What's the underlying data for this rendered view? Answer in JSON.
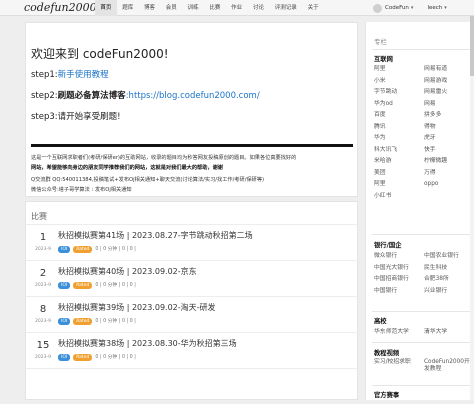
{
  "app": {
    "logo": "codefun2000"
  },
  "nav": {
    "items": [
      "首页",
      "题库",
      "博客",
      "会员",
      "训练",
      "比赛",
      "作业",
      "讨论",
      "评测记录",
      "关于"
    ],
    "active_index": 0,
    "user": "CodeFun",
    "extra_user": "leech"
  },
  "welcome": {
    "title": "欢迎来到 codeFun2000!",
    "step1_prefix": "step1:",
    "step1_link": "新手使用教程",
    "step2_prefix": "step2:",
    "step2_bold": "刷题必备算法博客",
    "step2_link": ":https://blog.codefun2000.com/",
    "step3": "step3:请开始享受刷题!",
    "info1": "这是一个互联网求职者们(考研/保研er)的互助网站，收录的题目均为秒答网友投稿原创的题目。如果各位真要找好的",
    "info2": "网站，希望能够向身边的朋友同学推荐我们的网站，这就是对我们最大的帮助，谢谢",
    "info3": "Q交流群 QQ:540011384,投稿笔试+发布Oj相关通知+聊天交流(讨论算法/实习/找工作/考研/保研等)",
    "info4": "微信公众号:塔子哥学算法 : 发布Oj相关通知"
  },
  "contests": {
    "title": "比赛",
    "items": [
      {
        "day": "1",
        "month": "2023-9",
        "name": "秋招模拟赛第41场 | 2023.08.27-字节跳动秋招第二场",
        "tag1": "IOI",
        "tag2": "Rated",
        "meta": "0 | 0 分钟 | 0 | 0 |"
      },
      {
        "day": "2",
        "month": "2023-9",
        "name": "秋招模拟赛第40场 | 2023.09.02-京东",
        "tag1": "IOI",
        "tag2": "Rated",
        "meta": "0 | 0 分钟 | 0 | 0 |"
      },
      {
        "day": "8",
        "month": "2023-9",
        "name": "秋招模拟赛第39场 | 2023.09.02-淘天-研发",
        "tag1": "IOI",
        "tag2": "Rated",
        "meta": "0 | 0 分钟 | 0 | 0 |"
      },
      {
        "day": "15",
        "month": "2023-9",
        "name": "秋招模拟赛第38场 | 2023.08.30-华为秋招第三场",
        "tag1": "IOI",
        "tag2": "Rated",
        "meta": "0 | 0 分钟 | 0 | 0 |"
      }
    ]
  },
  "sidebar": {
    "head": "专栏",
    "sec1": "互联网",
    "sec1_items": [
      "阿里",
      "网易有道",
      "小米",
      "网易游戏",
      "字节跳动",
      "网易雷火",
      "华为od",
      "网易",
      "百度",
      "拼多多",
      "腾讯",
      "得物",
      "华为",
      "虎牙",
      "科大讯飞",
      "快手",
      "米哈游",
      "柠檬微趣",
      "美团",
      "万得",
      "阿里",
      "oppo",
      "小红书",
      ""
    ],
    "sec2": "银行/国企",
    "sec2_items": [
      "微众银行",
      "中国农业银行",
      "中国光大银行",
      "民生科技",
      "中国招商银行",
      "合肥38所",
      "中国银行",
      "兴业银行"
    ],
    "sec3": "高校",
    "sec3_items": [
      "华东师范大学",
      "清华大学"
    ],
    "sec4": "教程视频",
    "sec4_items": [
      "实习/校招求职",
      "CodeFun2000开发教程"
    ],
    "sec5": "官方赛事"
  },
  "colors": {
    "link": "#1a73c8",
    "ioi": "#3a8fd8",
    "rated": "#f0a030"
  }
}
